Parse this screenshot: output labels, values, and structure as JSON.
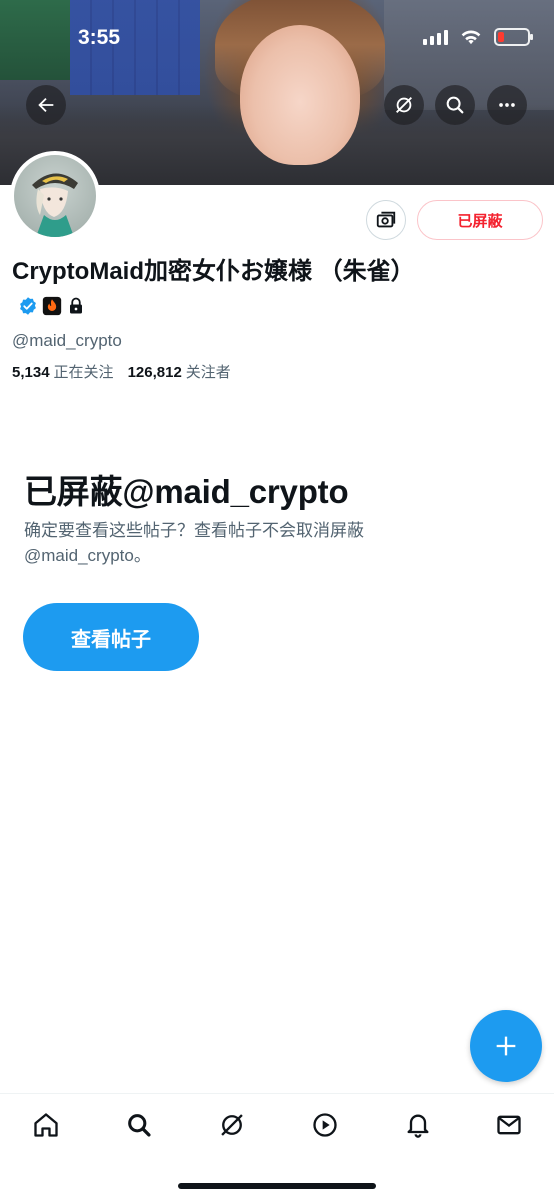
{
  "status_bar": {
    "time": "3:55"
  },
  "profile": {
    "display_name": "CryptoMaid加密女仆お嬢様 （朱雀）",
    "handle": "@maid_crypto",
    "following_count": "5,134",
    "following_label": "正在关注",
    "followers_count": "126,812",
    "followers_label": "关注者",
    "blocked_button_label": "已屏蔽"
  },
  "blocked_notice": {
    "title": "已屏蔽@maid_crypto",
    "description": "确定要查看这些帖子？查看帖子不会取消屏蔽 @maid_crypto。",
    "view_posts_label": "查看帖子"
  },
  "bottom_nav": {
    "items": [
      "home-icon",
      "search-icon",
      "grok-icon",
      "video-icon",
      "notifications-icon",
      "messages-icon"
    ]
  },
  "colors": {
    "accent": "#1d9bf0",
    "blocked_red": "#f4212e",
    "secondary_text": "#536471"
  }
}
